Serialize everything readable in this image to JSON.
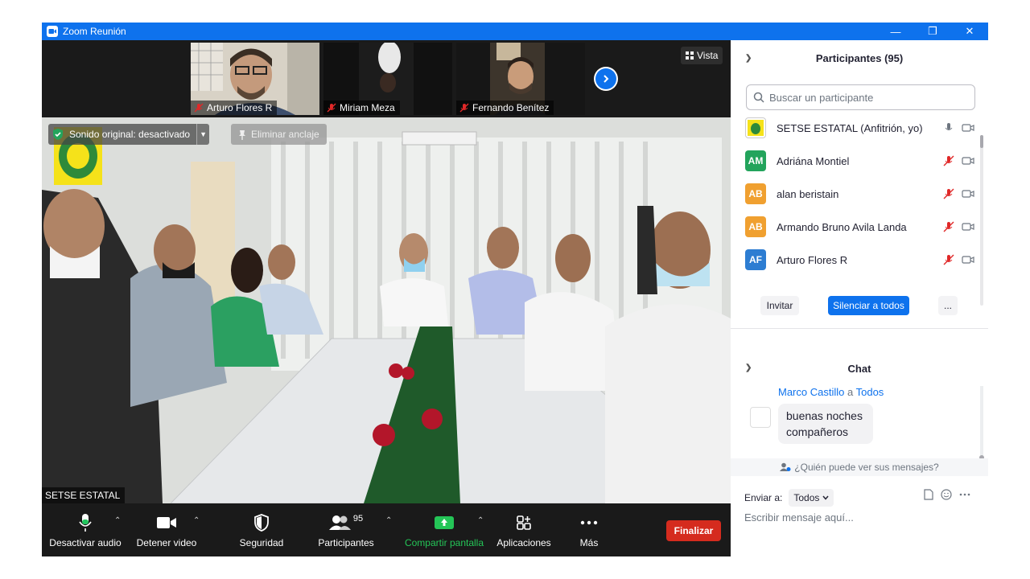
{
  "window": {
    "title": "Zoom Reunión",
    "minimize": "—",
    "restore": "❐",
    "close": "✕"
  },
  "strip": {
    "thumbs": [
      {
        "name": "Arturo Flores R"
      },
      {
        "name": "Miriam Meza"
      },
      {
        "name": "Fernando Benítez"
      }
    ],
    "view_label": "Vista"
  },
  "main": {
    "sound_label": "Sonido original: desactivado",
    "unpin_label": "Eliminar anclaje",
    "speaker_name": "SETSE ESTATAL"
  },
  "toolbar": {
    "mute": "Desactivar audio",
    "video": "Detener video",
    "security": "Seguridad",
    "participants": "Participantes",
    "participants_count": "95",
    "share": "Compartir pantalla",
    "apps": "Aplicaciones",
    "more": "Más",
    "end": "Finalizar"
  },
  "panel": {
    "header": "Participantes (95)",
    "search_placeholder": "Buscar un participante",
    "participants": [
      {
        "initials": "",
        "name": "SETSE ESTATAL (Anfitrión, yo)",
        "avatar_color": "#ffffff",
        "muted": false
      },
      {
        "initials": "AM",
        "name": "Adriána Montiel",
        "avatar_color": "#23a45c",
        "muted": true
      },
      {
        "initials": "AB",
        "name": "alan beristain",
        "avatar_color": "#f0a030",
        "muted": true
      },
      {
        "initials": "AB",
        "name": "Armando Bruno Avila Landa",
        "avatar_color": "#f0a030",
        "muted": true
      },
      {
        "initials": "AF",
        "name": "Arturo Flores R",
        "avatar_color": "#2d7dd2",
        "muted": true
      }
    ],
    "invite": "Invitar",
    "mute_all": "Silenciar a todos",
    "more": "...",
    "chat_header": "Chat",
    "message": {
      "from": "Marco Castillo",
      "a": "a",
      "to": "Todos",
      "text": "buenas noches compañeros"
    },
    "who_can_see": "¿Quién puede ver sus mensajes?",
    "send_to_label": "Enviar a:",
    "send_to_value": "Todos",
    "chat_placeholder": "Escribir mensaje aquí..."
  }
}
